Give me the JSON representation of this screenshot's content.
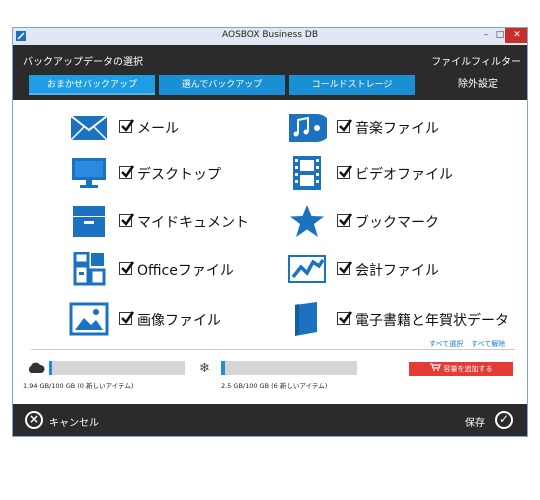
{
  "window": {
    "title": "AOSBOX Business DB",
    "minimize": "–",
    "maximize": "□",
    "close": "✕"
  },
  "header": {
    "title": "バックアップデータの選択",
    "file_filter": "ファイルフィルター",
    "tabs": [
      {
        "label": "おまかせバックアップ",
        "active": true
      },
      {
        "label": "選んでバックアップ",
        "active": false
      },
      {
        "label": "コールドストレージ",
        "active": false
      }
    ],
    "exclude_settings": "除外設定"
  },
  "items": [
    {
      "label": "メール",
      "icon": "envelope-icon",
      "checked": true
    },
    {
      "label": "音楽ファイル",
      "icon": "music-icon",
      "checked": true
    },
    {
      "label": "デスクトップ",
      "icon": "monitor-icon",
      "checked": true
    },
    {
      "label": "ビデオファイル",
      "icon": "film-icon",
      "checked": true
    },
    {
      "label": "マイドキュメント",
      "icon": "file-box-icon",
      "checked": true
    },
    {
      "label": "ブックマーク",
      "icon": "star-icon",
      "checked": true
    },
    {
      "label": "Officeファイル",
      "icon": "office-icon",
      "checked": true
    },
    {
      "label": "会計ファイル",
      "icon": "chart-icon",
      "checked": true
    },
    {
      "label": "画像ファイル",
      "icon": "image-icon",
      "checked": true
    },
    {
      "label": "電子書籍と年賀状データ",
      "icon": "book-icon",
      "checked": true
    }
  ],
  "links": {
    "select_all": "すべて選択",
    "deselect_all": "すべて解除"
  },
  "storage": {
    "cloud": {
      "usage_text": "1.94 GB/100 GB (0 新しいアイテム)",
      "fraction": 0.0194,
      "icon": "cloud-icon"
    },
    "cold": {
      "usage_text": "2.5 GB/100 GB (6 新しいアイテム)",
      "fraction": 0.025,
      "icon": "snowflake-icon"
    },
    "add_capacity": "容量を追加する"
  },
  "footer": {
    "cancel": "キャンセル",
    "save": "保存"
  },
  "colors": {
    "accent": "#1e8fe0",
    "header_bg": "#2b2b2b",
    "add_button": "#e33b36",
    "icon_blue": "#1a72c0"
  }
}
